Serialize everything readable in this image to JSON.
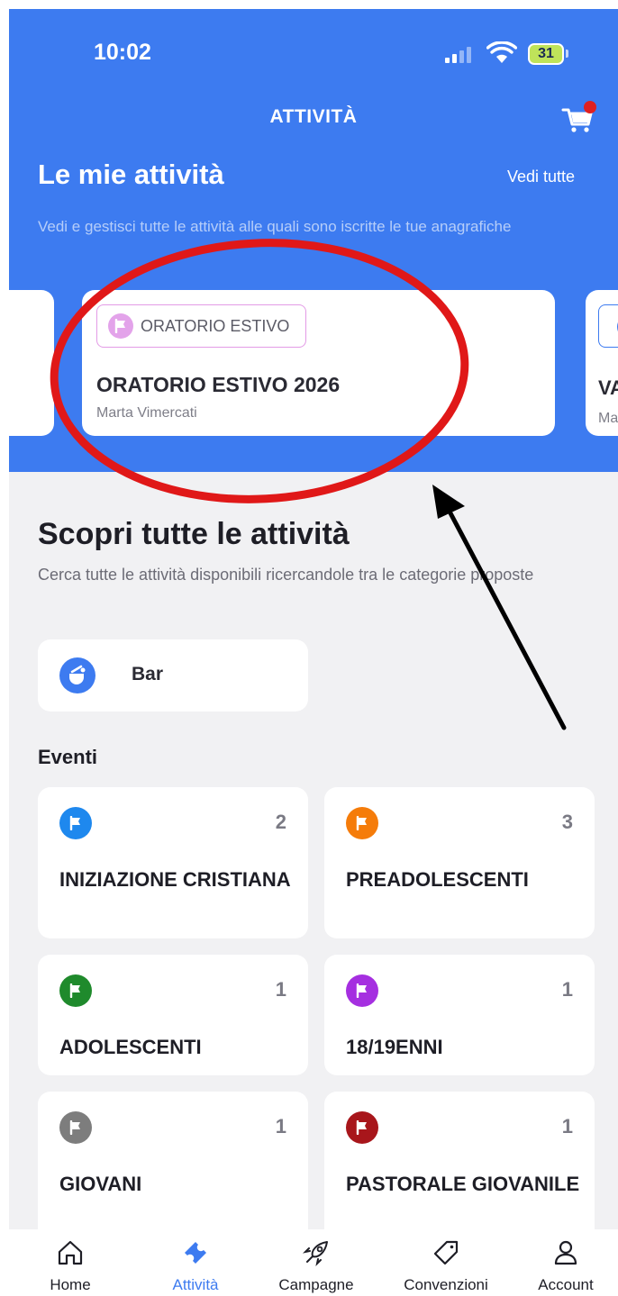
{
  "status_bar": {
    "time": "10:02",
    "battery": "31"
  },
  "nav": {
    "title": "ATTIVITÀ",
    "cart_icon": "cart-icon",
    "notification_color": "#e02020"
  },
  "my_activities": {
    "title": "Le mie attività",
    "see_all": "Vedi tutte",
    "subtitle": "Vedi e gestisci tutte le attività alle quali sono iscritte le tue anagrafiche",
    "cards": [
      {
        "tag": "ORATORIO ESTIVO",
        "title": "ORATORIO ESTIVO 2026",
        "person": "Marta Vimercati",
        "tag_color": "#e3a3ea"
      },
      {
        "title": "VA",
        "person": "Ma"
      }
    ]
  },
  "discover": {
    "title": "Scopri tutte le attività",
    "subtitle": "Cerca tutte le attività disponibili ricercandole tra le categorie proposte",
    "bar": {
      "label": "Bar",
      "icon": "bar-icon"
    }
  },
  "events": {
    "title": "Eventi",
    "items": [
      {
        "label": "INIZIAZIONE CRISTIANA",
        "count": "2",
        "color": "#1e88ee"
      },
      {
        "label": "PREADOLESCENTI",
        "count": "3",
        "color": "#f57c0a"
      },
      {
        "label": "ADOLESCENTI",
        "count": "1",
        "color": "#1f8a2c"
      },
      {
        "label": "18/19ENNI",
        "count": "1",
        "color": "#a52fe0"
      },
      {
        "label": "GIOVANI",
        "count": "1",
        "color": "#7d7d7d"
      },
      {
        "label": "PASTORALE GIOVANILE",
        "count": "1",
        "color": "#a8161b"
      }
    ]
  },
  "tabs": [
    {
      "label": "Home",
      "icon": "home-icon",
      "active": false
    },
    {
      "label": "Attività",
      "icon": "ticket-icon",
      "active": true
    },
    {
      "label": "Campagne",
      "icon": "rocket-icon",
      "active": false
    },
    {
      "label": "Convenzioni",
      "icon": "tag-icon",
      "active": false
    },
    {
      "label": "Account",
      "icon": "user-icon",
      "active": false
    }
  ],
  "colors": {
    "primary": "#3d7bf0",
    "background": "#f1f1f3",
    "annotation_red": "#e01818",
    "annotation_arrow": "#000000"
  }
}
